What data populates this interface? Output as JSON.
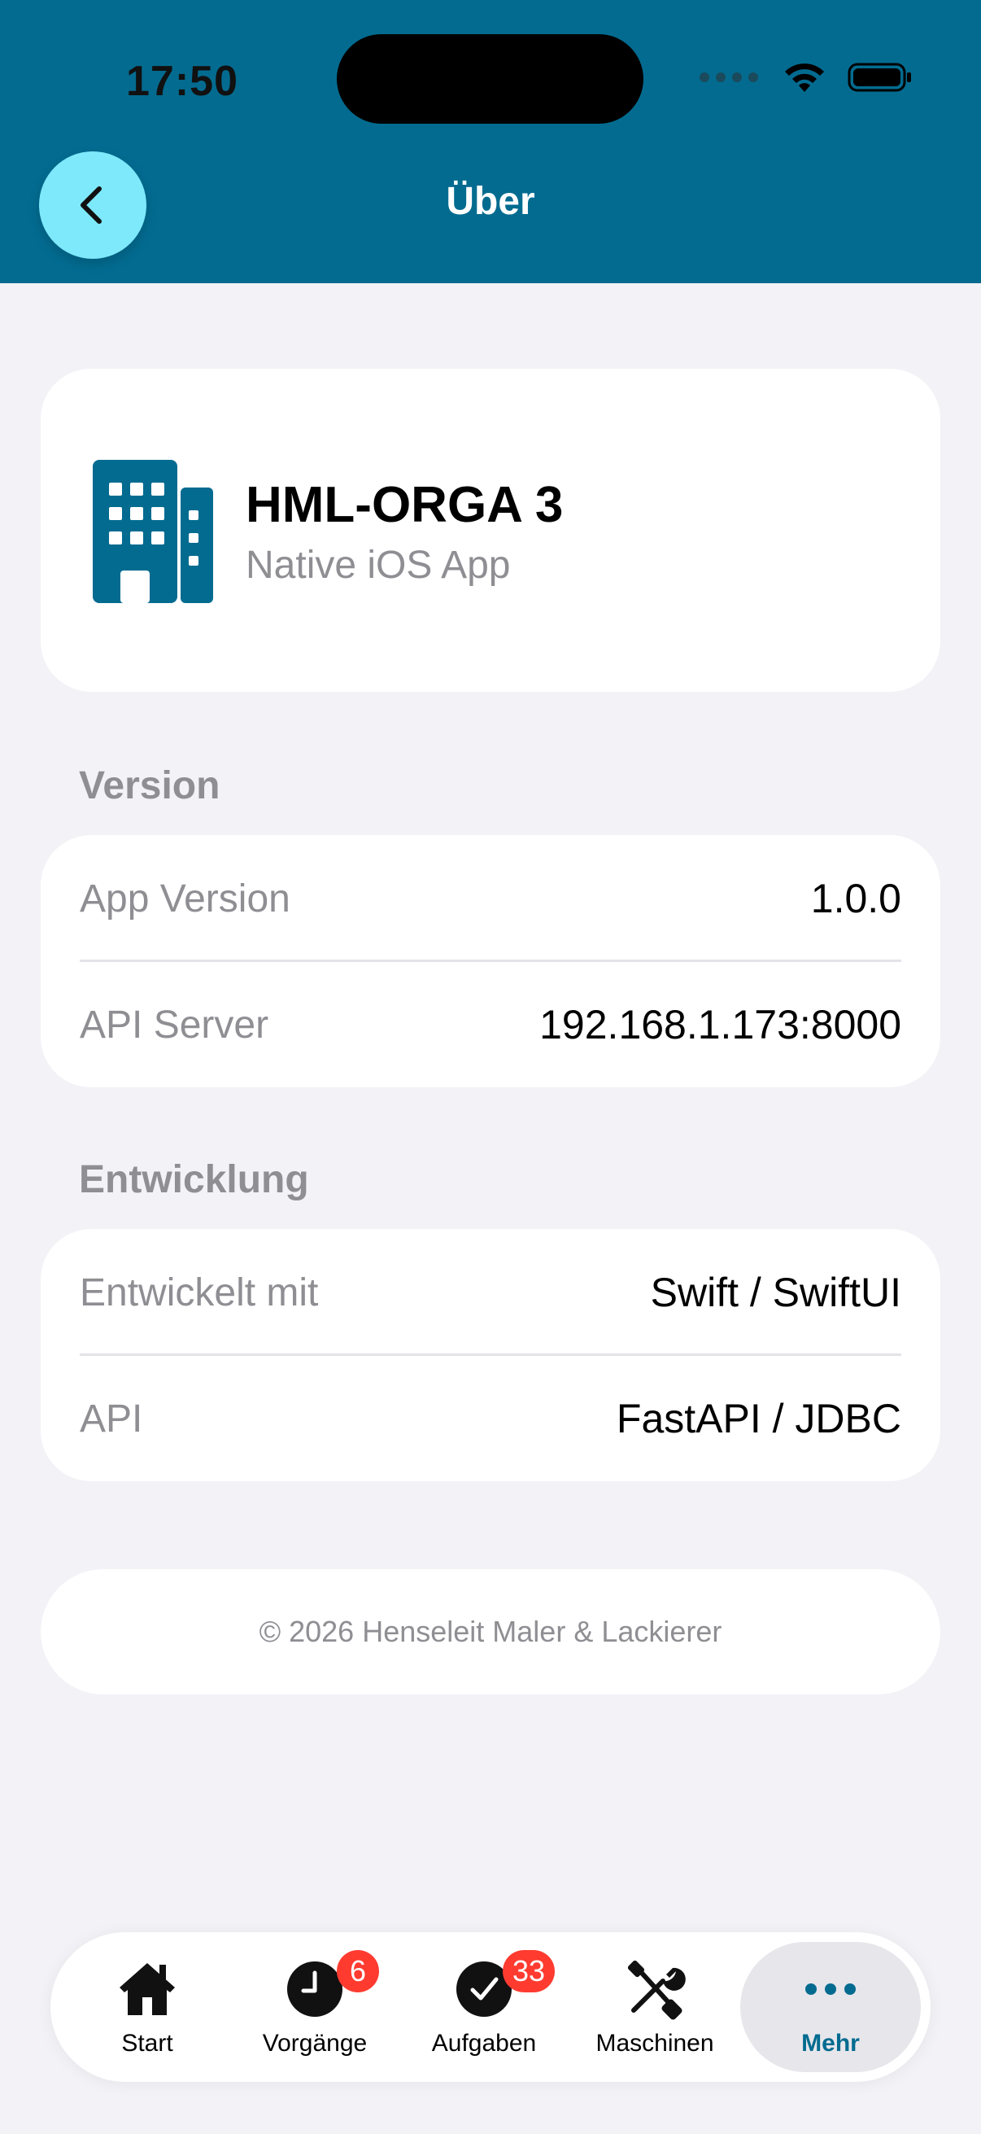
{
  "status_bar": {
    "time": "17:50"
  },
  "header": {
    "title": "Über"
  },
  "app_card": {
    "name": "HML-ORGA 3",
    "subtitle": "Native iOS App"
  },
  "sections": {
    "version": {
      "label": "Version",
      "rows": [
        {
          "label": "App Version",
          "value": "1.0.0"
        },
        {
          "label": "API Server",
          "value": "192.168.1.173:8000"
        }
      ]
    },
    "development": {
      "label": "Entwicklung",
      "rows": [
        {
          "label": "Entwickelt mit",
          "value": "Swift / SwiftUI"
        },
        {
          "label": "API",
          "value": "FastAPI / JDBC"
        }
      ]
    }
  },
  "footer": {
    "copyright": "© 2026 Henseleit Maler & Lackierer"
  },
  "tabbar": {
    "items": [
      {
        "label": "Start",
        "icon": "house-icon"
      },
      {
        "label": "Vorgänge",
        "icon": "clock-icon",
        "badge": "6"
      },
      {
        "label": "Aufgaben",
        "icon": "checkmark-icon",
        "badge": "33"
      },
      {
        "label": "Maschinen",
        "icon": "tools-icon"
      },
      {
        "label": "Mehr",
        "icon": "ellipsis-icon",
        "active": true
      }
    ]
  },
  "colors": {
    "header_bg": "#036B90",
    "back_button": "#7DE9FB",
    "accent": "#036B90",
    "badge": "#FF3B30",
    "background": "#F2F2F7"
  }
}
